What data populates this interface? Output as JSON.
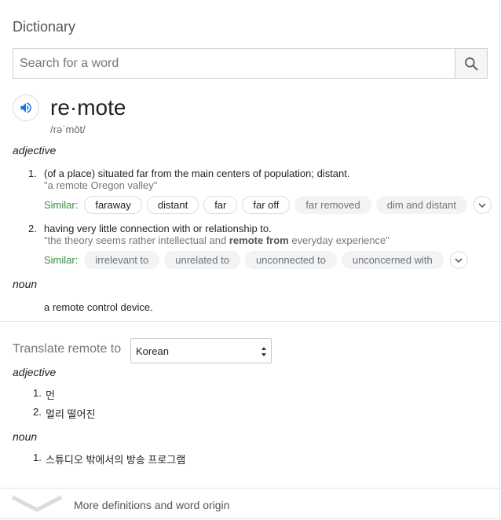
{
  "panel": {
    "title": "Dictionary"
  },
  "search": {
    "placeholder": "Search for a word",
    "value": ""
  },
  "entry": {
    "word": "re·mote",
    "phonetic": "/rəˈmōt/",
    "adjective_label": "adjective",
    "senses": [
      {
        "number": "1.",
        "definition": "(of a place) situated far from the main centers of population; distant.",
        "example": "\"a remote Oregon valley\"",
        "similar_label": "Similar:",
        "similar": [
          "faraway",
          "distant",
          "far",
          "far off",
          "far removed",
          "dim and distant"
        ]
      },
      {
        "number": "2.",
        "definition": "having very little connection with or relationship to.",
        "example_pre": "\"the theory seems rather intellectual and ",
        "example_bold": "remote from",
        "example_post": " everyday experience\"",
        "similar_label": "Similar:",
        "similar": [
          "irrelevant to",
          "unrelated to",
          "unconnected to",
          "unconcerned with"
        ]
      }
    ],
    "noun_label": "noun",
    "noun_definition": "a remote control device."
  },
  "translate": {
    "label": "Translate remote to",
    "language": "Korean",
    "adjective_label": "adjective",
    "adjective_items": [
      {
        "number": "1.",
        "text": "먼"
      },
      {
        "number": "2.",
        "text": "멀리 떨어진"
      }
    ],
    "noun_label": "noun",
    "noun_items": [
      {
        "number": "1.",
        "text": "스튜디오 밖에서의 방송 프로그램"
      }
    ]
  },
  "footer": {
    "more_label": "More definitions and word origin"
  },
  "colors": {
    "similar_green": "#388e3c",
    "speaker_blue": "#1a73e8",
    "chip_gray": "#f1f3f4"
  },
  "icons": {
    "search": "search-icon",
    "speaker": "speaker-icon",
    "expand": "chevron-down-icon",
    "more": "chevron-down-icon"
  }
}
